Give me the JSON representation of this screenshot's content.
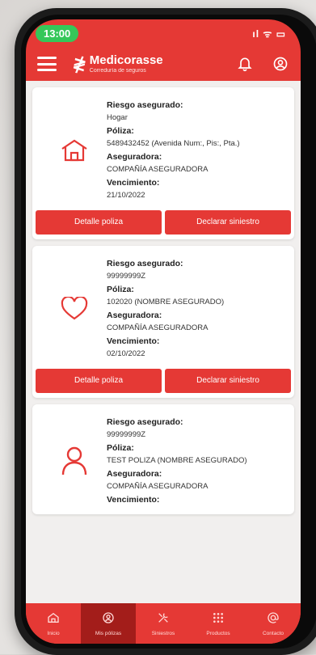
{
  "status": {
    "time": "13:00",
    "signal": "ıl ᯤ ▭"
  },
  "appbar": {
    "brand_name": "Medicorasse",
    "brand_tag": "Correduría de seguros"
  },
  "policies": [
    {
      "icon": "house-icon",
      "fields": [
        {
          "label": "Riesgo asegurado:",
          "value": "Hogar"
        },
        {
          "label": "Póliza:",
          "value": "5489432452 (Avenida Num:, Pis:, Pta.)"
        },
        {
          "label": "Aseguradora:",
          "value": "COMPAÑÍA ASEGURADORA"
        },
        {
          "label": "Vencimiento:",
          "value": "21/10/2022"
        }
      ],
      "buttons": [
        "Detalle poliza",
        "Declarar siniestro"
      ]
    },
    {
      "icon": "heart-icon",
      "fields": [
        {
          "label": "Riesgo asegurado:",
          "value": "99999999Z"
        },
        {
          "label": "Póliza:",
          "value": "102020 (NOMBRE ASEGURADO)"
        },
        {
          "label": "Aseguradora:",
          "value": "COMPAÑÍA ASEGURADORA"
        },
        {
          "label": "Vencimiento:",
          "value": "02/10/2022"
        }
      ],
      "buttons": [
        "Detalle poliza",
        "Declarar siniestro"
      ]
    },
    {
      "icon": "person-icon",
      "fields": [
        {
          "label": "Riesgo asegurado:",
          "value": "99999999Z"
        },
        {
          "label": "Póliza:",
          "value": "TEST POLIZA (NOMBRE ASEGURADO)"
        },
        {
          "label": "Aseguradora:",
          "value": "COMPAÑÍA ASEGURADORA"
        },
        {
          "label": "Vencimiento:",
          "value": ""
        }
      ],
      "buttons": []
    }
  ],
  "tabs": [
    {
      "label": "Inicio",
      "icon": "home-icon"
    },
    {
      "label": "Mis pólizas",
      "icon": "shield-icon"
    },
    {
      "label": "Siniestros",
      "icon": "tools-icon"
    },
    {
      "label": "Productos",
      "icon": "grid-icon"
    },
    {
      "label": "Contacto",
      "icon": "at-icon"
    }
  ],
  "active_tab": 1,
  "colors": {
    "primary": "#e53935",
    "active_tab": "#a31d1a",
    "time_pill": "#35c759"
  }
}
